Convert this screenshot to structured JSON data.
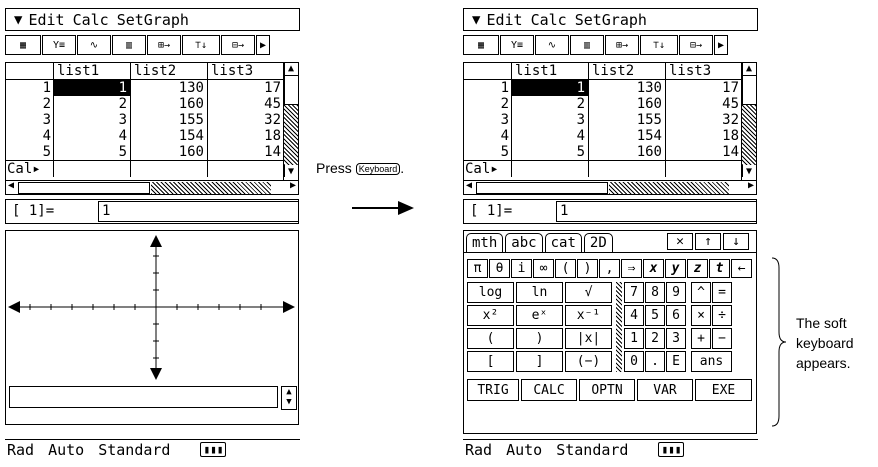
{
  "menu": {
    "items": [
      "Edit",
      "Calc",
      "SetGraph"
    ]
  },
  "table": {
    "headers": [
      "list1",
      "list2",
      "list3"
    ],
    "rows": [
      [
        "1",
        "1",
        "130",
        "17"
      ],
      [
        "2",
        "2",
        "160",
        "45"
      ],
      [
        "3",
        "3",
        "155",
        "32"
      ],
      [
        "4",
        "4",
        "154",
        "18"
      ],
      [
        "5",
        "5",
        "160",
        "14"
      ]
    ],
    "calc_label": "Cal▸"
  },
  "edit": {
    "index": "[   1]=",
    "value": "1"
  },
  "status": {
    "angle": "Rad",
    "mode": "Auto",
    "display": "Standard"
  },
  "keyboard": {
    "tabs": [
      "mth",
      "abc",
      "cat",
      "2D"
    ],
    "top_icons": [
      "close-icon",
      "up-icon",
      "down-icon"
    ],
    "symbols": [
      "π",
      "θ",
      "i",
      "∞",
      "(",
      ")",
      ",",
      "⇒",
      "x",
      "y",
      "z",
      "t",
      "←"
    ],
    "funcs": [
      [
        "log",
        "ln",
        "√"
      ],
      [
        "x²",
        "eˣ",
        "x⁻¹"
      ],
      [
        "(",
        ")",
        "|x|"
      ],
      [
        "[",
        "]",
        "(−)"
      ]
    ],
    "digits": [
      [
        "7",
        "8",
        "9"
      ],
      [
        "4",
        "5",
        "6"
      ],
      [
        "1",
        "2",
        "3"
      ],
      [
        "0",
        ".",
        "E"
      ]
    ],
    "ops": [
      [
        "^",
        "="
      ],
      [
        "×",
        "÷"
      ],
      [
        "+",
        "−"
      ],
      [
        "ans"
      ]
    ],
    "bottom": [
      "TRIG",
      "CALC",
      "OPTN",
      "VAR",
      "EXE"
    ]
  },
  "captions": {
    "press": "Press",
    "key": "Keyboard",
    "dot": ".",
    "soft": [
      "The soft",
      "keyboard",
      "appears."
    ]
  }
}
